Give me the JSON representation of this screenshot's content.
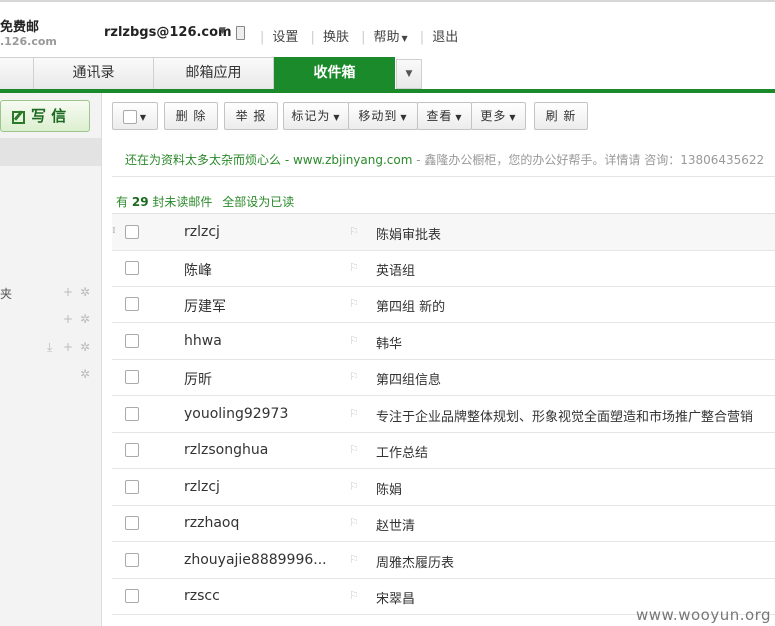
{
  "brand": {
    "title": "免费邮",
    "domain": ".126.com"
  },
  "account": {
    "email": "rzlzbgs@126.com"
  },
  "top_links": [
    "设置",
    "换肤",
    "帮助",
    "退出"
  ],
  "tabs": [
    {
      "label": "通讯录"
    },
    {
      "label": "邮箱应用"
    },
    {
      "label": "收件箱"
    }
  ],
  "sidebar": {
    "compose_label": "写 信",
    "folder_fragment": "夹"
  },
  "toolbar": {
    "delete": "删 除",
    "report": "举 报",
    "mark_as": "标记为",
    "move_to": "移动到",
    "view": "查看",
    "more": "更多",
    "refresh": "刷 新"
  },
  "promo": {
    "text": "还在为资料太多太杂而烦心么 - www.zbjinyang.com",
    "extra": " - 鑫隆办公橱柜，您的办公好帮手。详情请 咨询：13806435622"
  },
  "unread": {
    "prefix": "有",
    "count": "29",
    "suffix": "封未读邮件",
    "mark_all": "全部设为已读"
  },
  "emails": [
    {
      "sender": "rzlzcj",
      "subject": "陈娟审批表"
    },
    {
      "sender": "陈峰",
      "subject": "英语组"
    },
    {
      "sender": "厉建军",
      "subject": "第四组 新的"
    },
    {
      "sender": "hhwa",
      "subject": "韩华"
    },
    {
      "sender": "厉昕",
      "subject": "第四组信息"
    },
    {
      "sender": "youoling92973",
      "subject": "专注于企业品牌整体规划、形象视觉全面塑造和市场推广整合营销"
    },
    {
      "sender": "rzlzsonghua",
      "subject": "工作总结"
    },
    {
      "sender": "rzlzcj",
      "subject": "陈娟"
    },
    {
      "sender": "rzzhaoq",
      "subject": "赵世清"
    },
    {
      "sender": "zhouyajie8889996...",
      "subject": "周雅杰履历表"
    },
    {
      "sender": "rzscc",
      "subject": "宋翠昌"
    }
  ],
  "watermark": "www.wooyun.org"
}
